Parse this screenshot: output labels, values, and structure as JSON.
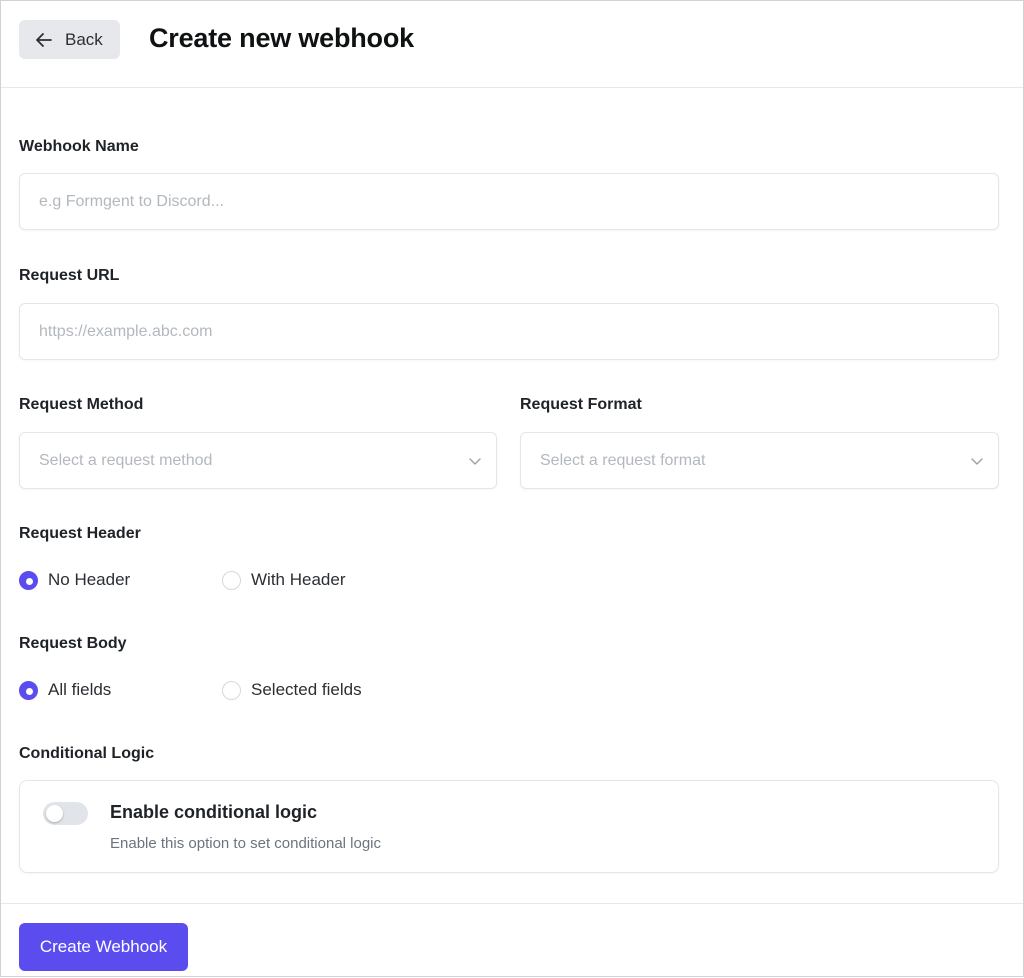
{
  "header": {
    "back_label": "Back",
    "title": "Create new webhook"
  },
  "form": {
    "webhook_name": {
      "label": "Webhook Name",
      "placeholder": "e.g Formgent to Discord..."
    },
    "request_url": {
      "label": "Request URL",
      "placeholder": "https://example.abc.com"
    },
    "request_method": {
      "label": "Request Method",
      "placeholder": "Select a request method"
    },
    "request_format": {
      "label": "Request Format",
      "placeholder": "Select a request format"
    },
    "request_header": {
      "label": "Request Header",
      "options": [
        {
          "label": "No Header",
          "selected": true
        },
        {
          "label": "With Header",
          "selected": false
        }
      ]
    },
    "request_body": {
      "label": "Request Body",
      "options": [
        {
          "label": "All fields",
          "selected": true
        },
        {
          "label": "Selected fields",
          "selected": false
        }
      ]
    },
    "conditional_logic": {
      "label": "Conditional Logic",
      "toggle_title": "Enable conditional logic",
      "toggle_description": "Enable this option to set conditional logic",
      "enabled": false
    }
  },
  "footer": {
    "submit_label": "Create Webhook"
  },
  "colors": {
    "accent": "#5b4cf0",
    "back_button_bg": "#e6e8eb",
    "placeholder": "#b3b8be"
  }
}
